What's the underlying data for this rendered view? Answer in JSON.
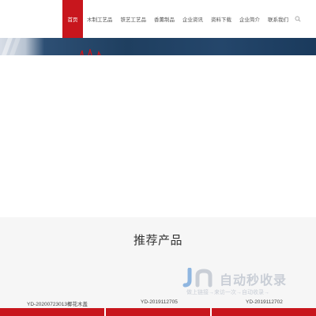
{
  "nav": {
    "items": [
      {
        "label": "首页",
        "active": true
      },
      {
        "label": "木制工艺品",
        "active": false
      },
      {
        "label": "铁艺工艺品",
        "active": false
      },
      {
        "label": "香薰制品",
        "active": false
      },
      {
        "label": "企业资讯",
        "active": false
      },
      {
        "label": "资料下载",
        "active": false
      },
      {
        "label": "企业简介",
        "active": false
      },
      {
        "label": "联系我们",
        "active": false
      }
    ],
    "search_icon": "search-icon",
    "accent_color": "#c8161d"
  },
  "recommend": {
    "title": "推荐产品",
    "products": [
      {
        "code": "YD-20200723013椰花木盖"
      },
      {
        "code": "YD-2019112705"
      },
      {
        "code": "YD-2019112702"
      }
    ]
  },
  "watermark": {
    "brand": "自动秒收录",
    "sub": "做上链接→来访一次→自动收录→"
  }
}
